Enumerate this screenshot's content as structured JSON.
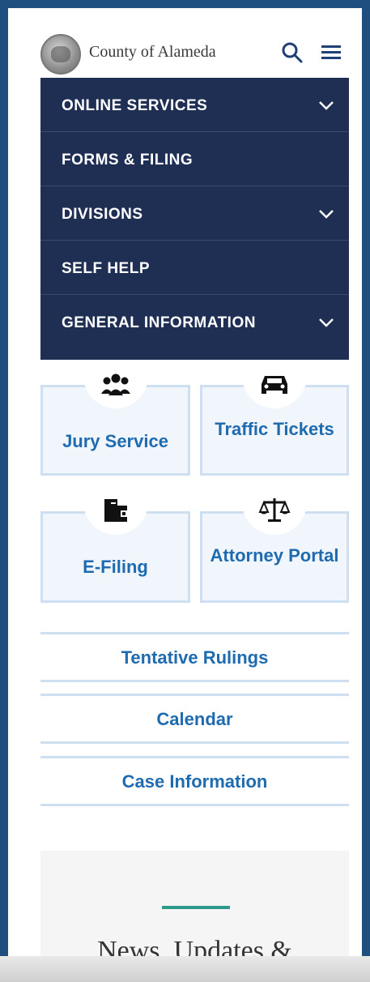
{
  "header": {
    "brand": "County of Alameda",
    "search_icon": "search-icon",
    "menu_icon": "menu-icon"
  },
  "nav": {
    "items": [
      {
        "label": "ONLINE SERVICES",
        "has_chevron": true
      },
      {
        "label": "FORMS & FILING",
        "has_chevron": false
      },
      {
        "label": "DIVISIONS",
        "has_chevron": true
      },
      {
        "label": "SELF HELP",
        "has_chevron": false
      },
      {
        "label": "GENERAL INFORMATION",
        "has_chevron": true
      }
    ]
  },
  "cards": [
    {
      "label": "Jury Service",
      "icon": "people-icon"
    },
    {
      "label": "Traffic Tickets",
      "icon": "car-icon"
    },
    {
      "label": "E-Filing",
      "icon": "folder-icon"
    },
    {
      "label": "Attorney Portal",
      "icon": "scales-icon"
    }
  ],
  "links": [
    {
      "label": "Tentative Rulings"
    },
    {
      "label": "Calendar"
    },
    {
      "label": "Case Information"
    }
  ],
  "news": {
    "title": "News, Updates &"
  },
  "colors": {
    "nav_bg": "#1f2f54",
    "link_blue": "#1f6bb0",
    "card_bg": "#f1f6fc",
    "card_border": "#cddff0",
    "accent": "#2a9a8c"
  }
}
